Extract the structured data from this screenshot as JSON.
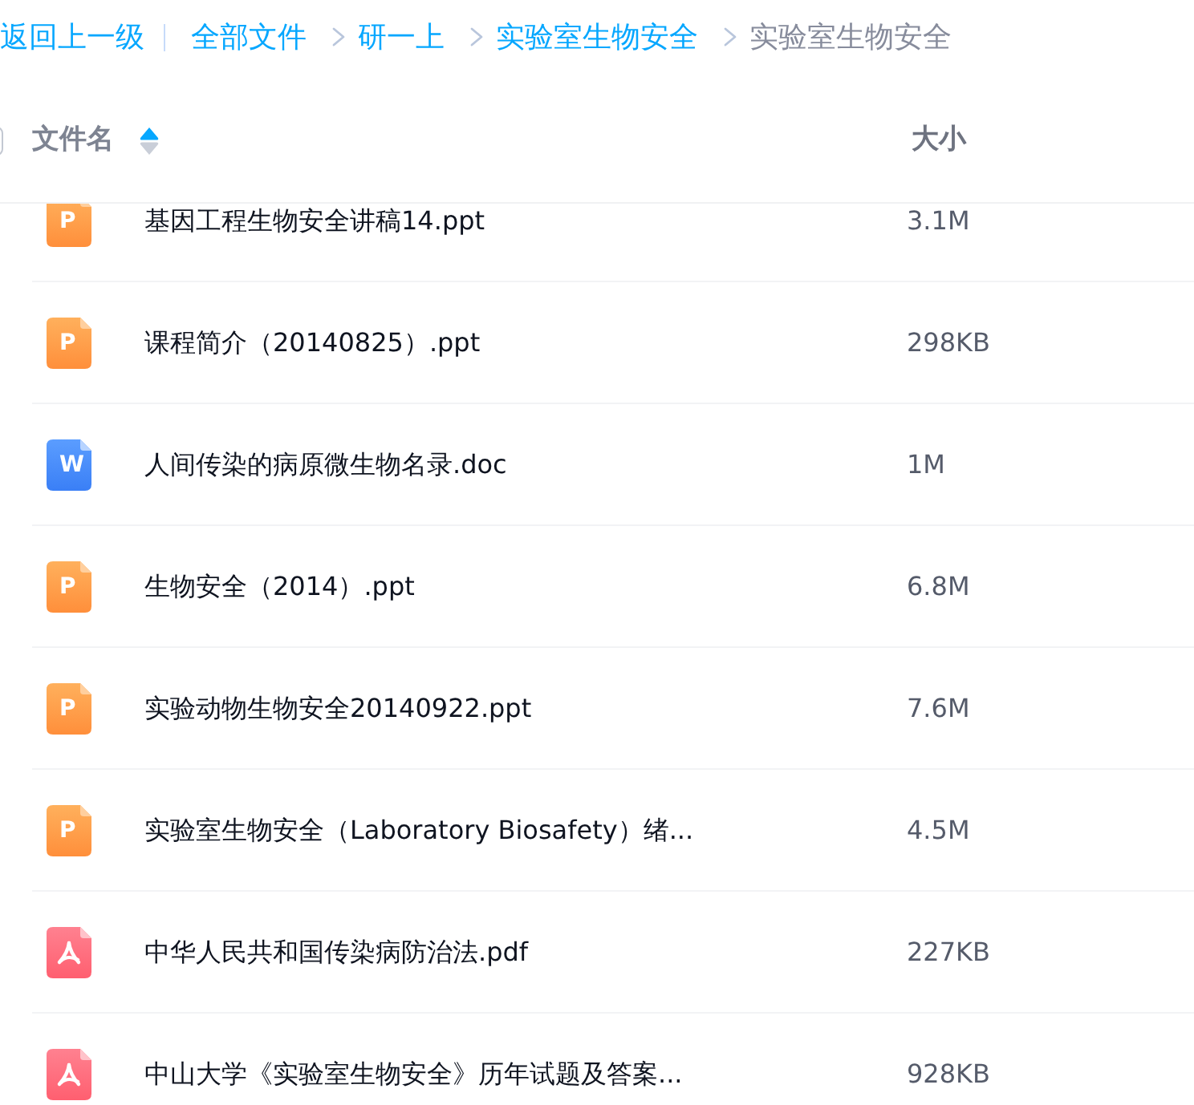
{
  "breadcrumb": {
    "back": "返回上一级",
    "items": [
      {
        "label": "全部文件",
        "current": false
      },
      {
        "label": "研一上",
        "current": false
      },
      {
        "label": "实验室生物安全",
        "current": false
      },
      {
        "label": "实验室生物安全",
        "current": true
      }
    ]
  },
  "header": {
    "select_all": {
      "checked": false
    },
    "columns": [
      {
        "label": "文件名",
        "sorted": true
      },
      {
        "label": "大小"
      }
    ]
  },
  "files": [
    {
      "kind": "ppt",
      "icon_letter": "P",
      "name": "基因工程生物安全讲稿14.ppt",
      "size": "3.1M"
    },
    {
      "kind": "ppt",
      "icon_letter": "P",
      "name": "课程简介（20140825）.ppt",
      "size": "298KB"
    },
    {
      "kind": "doc",
      "icon_letter": "W",
      "name": "人间传染的病原微生物名录.doc",
      "size": "1M"
    },
    {
      "kind": "ppt",
      "icon_letter": "P",
      "name": "生物安全（2014）.ppt",
      "size": "6.8M"
    },
    {
      "kind": "ppt",
      "icon_letter": "P",
      "name": "实验动物生物安全20140922.ppt",
      "size": "7.6M"
    },
    {
      "kind": "ppt",
      "icon_letter": "P",
      "name": "实验室生物安全（Laboratory Biosafety）绪...",
      "size": "4.5M"
    },
    {
      "kind": "pdf",
      "name": "中华人民共和国传染病防治法.pdf",
      "size": "227KB"
    },
    {
      "kind": "pdf",
      "name": "中山大学《实验室生物安全》历年试题及答案...",
      "size": "928KB"
    }
  ]
}
